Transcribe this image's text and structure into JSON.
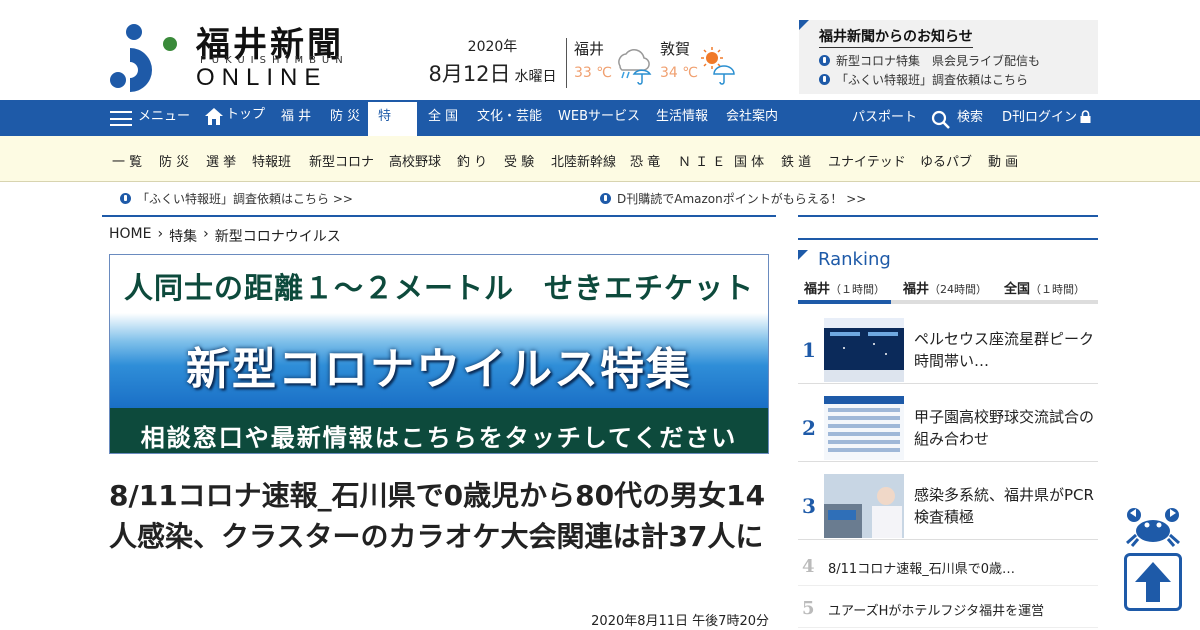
{
  "logo": {
    "title": "福井新聞",
    "sub": "FUKUISHIMBUN",
    "online": "ONLINE"
  },
  "date": {
    "year": "2020年",
    "monthday": "8月12日",
    "dow": "水曜日"
  },
  "weather": [
    {
      "city": "福井",
      "temp": "33 ℃",
      "icon": "cloud-rain-umbrella-icon"
    },
    {
      "city": "敦賀",
      "temp": "34 ℃",
      "icon": "sun-umbrella-icon"
    }
  ],
  "notice": {
    "title": "福井新聞からのお知らせ",
    "items": [
      "新型コロナ特集　県会見ライブ配信も",
      "「ふくい特報班」調査依頼はこちら"
    ]
  },
  "nav": {
    "menu": "メニュー",
    "top": "トップ",
    "items": [
      "福 井",
      "防 災",
      "特 集",
      "全 国",
      "文化・芸能",
      "WEBサービス",
      "生活情報",
      "会社案内"
    ],
    "passport": "パスポート",
    "search": "検索",
    "login": "D刊ログイン"
  },
  "subnav": [
    "一 覧",
    "防 災",
    "選 挙",
    "特報班",
    "新型コロナ",
    "高校野球",
    "釣 り",
    "受 験",
    "北陸新幹線",
    "恐 竜",
    "Ｎ Ｉ Ｅ",
    "国 体",
    "鉄 道",
    "ユナイテッド",
    "ゆるパブ",
    "動 画"
  ],
  "infobar": [
    "「ふくい特報班」調査依頼はこちら >>",
    "D刊購読でAmazonポイントがもらえる！ >>"
  ],
  "breadcrumb": [
    "HOME",
    "特集",
    "新型コロナウイルス"
  ],
  "banner": {
    "top": "人同士の距離１～２メートル　せきエチケット",
    "middle": "新型コロナウイルス特集",
    "bottom": "相談窓口や最新情報はこちらをタッチしてください"
  },
  "article": {
    "headline": "8/11コロナ速報_石川県で0歳児から80代の男女14人感染、クラスターのカラオケ大会関連は計37人に",
    "date": "2020年8月11日 午後7時20分"
  },
  "ranking": {
    "title": "Ranking",
    "tabs": [
      {
        "label": "福井",
        "sub": "（１時間）"
      },
      {
        "label": "福井",
        "sub": "（24時間）"
      },
      {
        "label": "全国",
        "sub": "（１時間）"
      }
    ],
    "items": [
      {
        "rank": "1",
        "text": "ペルセウス座流星群ピーク時間帯い…"
      },
      {
        "rank": "2",
        "text": "甲子園高校野球交流試合の組み合わせ"
      },
      {
        "rank": "3",
        "text": "感染多系統、福井県がPCR検査積極"
      },
      {
        "rank": "4",
        "text": "8/11コロナ速報_石川県で0歳…"
      },
      {
        "rank": "5",
        "text": "ユアーズHがホテルフジタ福井を運営"
      }
    ]
  },
  "colors": {
    "brand": "#1e5aa8",
    "dark_green": "#0d4a3c",
    "subnav_bg": "#fdfbe3"
  }
}
